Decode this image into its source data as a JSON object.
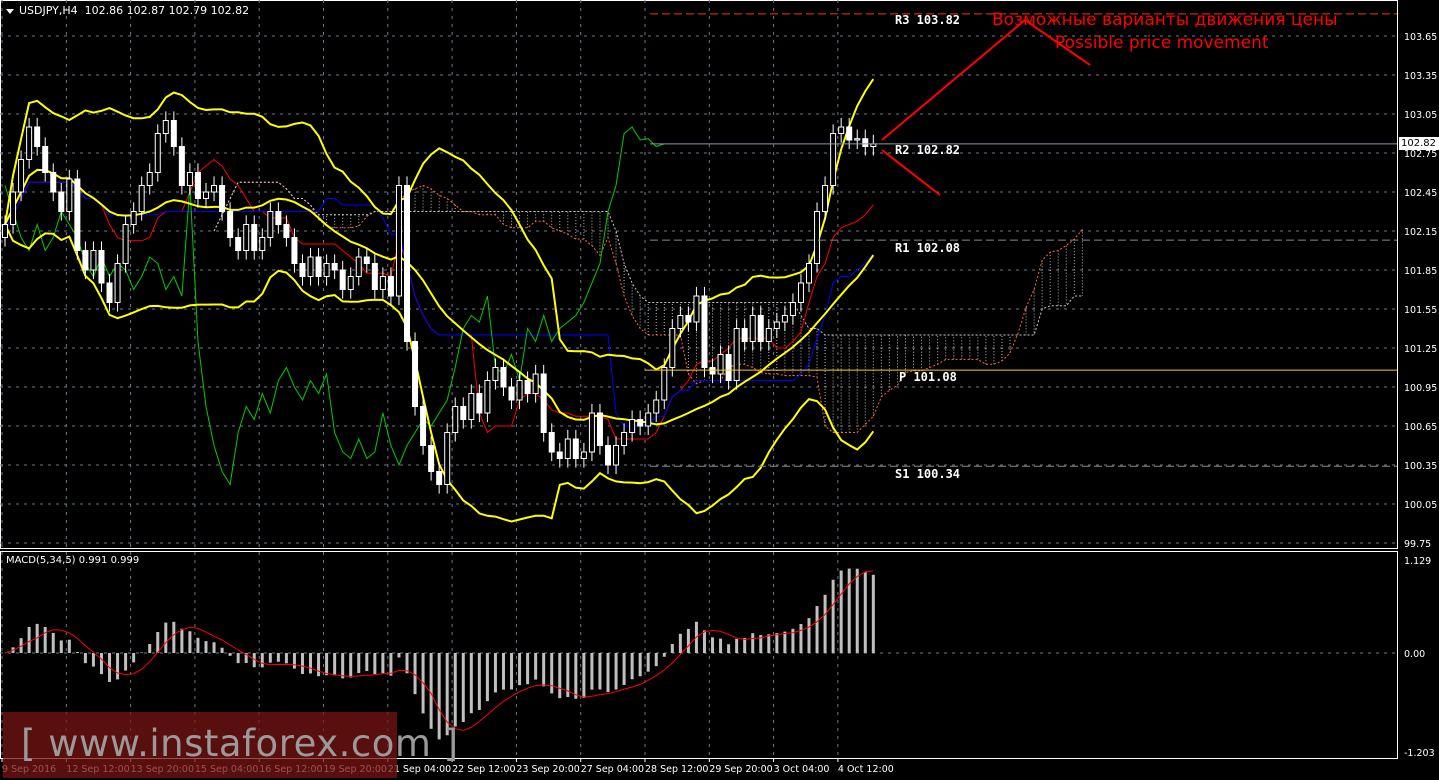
{
  "header": {
    "symbol": "USDJPY,H4",
    "ohlc": "102.86 102.87 102.79 102.82"
  },
  "macd_label": "MACD(5,34,5) 0.991 0.999",
  "levels": [
    {
      "label": "R3 103.82",
      "price": 103.82,
      "color": "#ff3300",
      "style": "dashed"
    },
    {
      "label": "R2 102.82",
      "price": 102.82,
      "color": "#8899aa",
      "style": "solid"
    },
    {
      "label": "R1 102.08",
      "price": 102.08,
      "color": "#888888",
      "style": "dashed"
    },
    {
      "label": "P 101.08",
      "price": 101.08,
      "color": "#ffcc00",
      "style": "solid"
    },
    {
      "label": "S1 100.34",
      "price": 100.34,
      "color": "#888888",
      "style": "dashed"
    }
  ],
  "annotation": {
    "line1": "Возможные варианты движения цены",
    "line2": "Possible price movement",
    "color": "#ff0000"
  },
  "watermark": "[ www.instaforex.com ]",
  "current_price": "102.82",
  "chart_data": [
    {
      "type": "candlestick",
      "title": "USDJPY,H4",
      "ylim": [
        99.7,
        103.95
      ],
      "y_ticks": [
        "103.65",
        "103.35",
        "103.05",
        "102.75",
        "102.45",
        "102.15",
        "101.85",
        "101.55",
        "101.25",
        "100.95",
        "100.65",
        "100.35",
        "100.05",
        "99.75"
      ],
      "x_ticks": [
        "9 Sep 2016",
        "12 Sep 12:00",
        "13 Sep 20:00",
        "15 Sep 04:00",
        "16 Sep 12:00",
        "19 Sep 20:00",
        "21 Sep 04:00",
        "22 Sep 12:00",
        "23 Sep 20:00",
        "27 Sep 04:00",
        "28 Sep 12:00",
        "29 Sep 20:00",
        "3 Oct 04:00",
        "4 Oct 12:00"
      ],
      "close": [
        102.2,
        102.45,
        102.7,
        102.95,
        102.8,
        102.6,
        102.45,
        102.3,
        102.55,
        102.0,
        101.85,
        102.0,
        101.75,
        101.6,
        101.9,
        102.2,
        102.3,
        102.5,
        102.6,
        102.9,
        103.0,
        102.8,
        102.5,
        102.6,
        102.4,
        102.45,
        102.5,
        102.3,
        102.1,
        102.0,
        102.2,
        102.0,
        102.1,
        102.3,
        102.2,
        102.1,
        101.9,
        101.8,
        101.95,
        101.8,
        101.9,
        101.85,
        101.7,
        101.8,
        101.95,
        101.9,
        101.7,
        101.8,
        101.65,
        102.5,
        101.3,
        100.8,
        100.5,
        100.3,
        100.2,
        100.6,
        100.8,
        100.7,
        100.9,
        100.75,
        101.0,
        101.1,
        100.95,
        100.85,
        101.0,
        100.9,
        101.05,
        100.6,
        100.45,
        100.4,
        100.55,
        100.4,
        100.45,
        100.75,
        100.5,
        100.35,
        100.5,
        100.6,
        100.7,
        100.65,
        100.75,
        100.85,
        101.1,
        101.4,
        101.5,
        101.45,
        101.65,
        101.1,
        101.05,
        101.2,
        101.0,
        101.4,
        101.3,
        101.5,
        101.3,
        101.4,
        101.45,
        101.5,
        101.6,
        101.75,
        101.9,
        102.3,
        102.5,
        102.9,
        102.95,
        102.85,
        102.86,
        102.8,
        102.82
      ],
      "indicators": [
        "Bollinger Bands",
        "Ichimoku Kinko Hyo"
      ],
      "colors": {
        "bull": "#ffffff",
        "bear": "#ffffff",
        "bollinger": "#ffff00",
        "tenkan": "#ff0000",
        "kijun": "#0000ff",
        "chikou": "#00cc00",
        "span_a": "#ff6633",
        "span_b": "#cccccc"
      },
      "grid": true
    },
    {
      "type": "bar",
      "title": "MACD(5,34,5)",
      "main": 0.991,
      "signal": 0.999,
      "ylim": [
        -1.203,
        1.129
      ],
      "y_ticks": [
        "1.129",
        "0.00",
        "-1.203"
      ],
      "colors": {
        "histogram": "#c0c0c0",
        "signal": "#ff0000"
      }
    }
  ]
}
